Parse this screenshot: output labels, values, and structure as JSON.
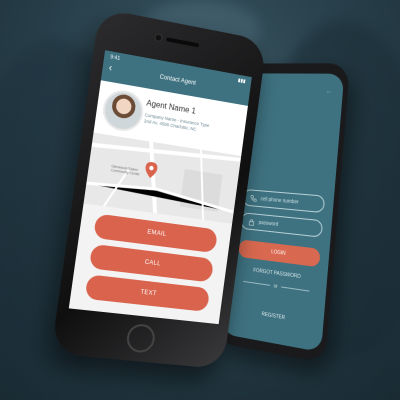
{
  "back_phone": {
    "top_text": "...",
    "phone_placeholder": "cell phone number",
    "password_placeholder": "password",
    "login_label": "LOGIN",
    "forgot_label": "FORGOT PASSWORD",
    "or_label": "or",
    "register_label": "REGISTER"
  },
  "front_phone": {
    "status_time": "9:41",
    "status_right": "▮▮▮",
    "header_title": "Contact Agent",
    "back_glyph": "‹",
    "agent_name": "Agent Name 1",
    "company_line": "Company Name - Insurance Type",
    "address_line": "2nd Av. 4566 Charlotte, NC",
    "map_label": "Glenwood-Salem Community Center",
    "buttons": {
      "email": "EMAIL",
      "call": "CALL",
      "text": "TEXT"
    }
  },
  "colors": {
    "teal": "#3e7281",
    "coral": "#d9634c"
  }
}
